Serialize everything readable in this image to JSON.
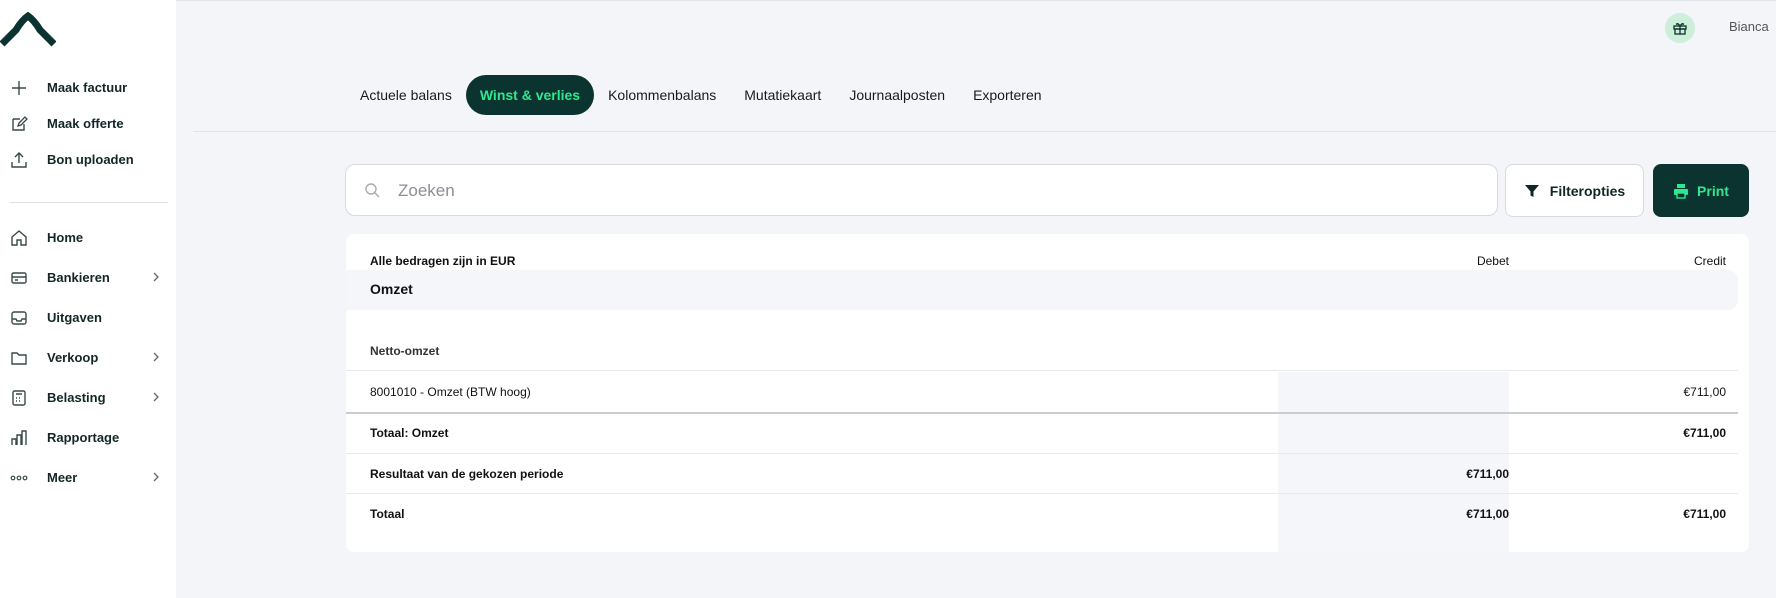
{
  "sidebar": {
    "actions": [
      {
        "label": "Maak factuur",
        "icon": "plus-icon"
      },
      {
        "label": "Maak offerte",
        "icon": "edit-icon"
      },
      {
        "label": "Bon uploaden",
        "icon": "upload-icon"
      }
    ],
    "nav": [
      {
        "label": "Home",
        "icon": "home-icon",
        "chevron": false
      },
      {
        "label": "Bankieren",
        "icon": "bank-card-icon",
        "chevron": true
      },
      {
        "label": "Uitgaven",
        "icon": "inbox-icon",
        "chevron": false
      },
      {
        "label": "Verkoop",
        "icon": "folder-icon",
        "chevron": true
      },
      {
        "label": "Belasting",
        "icon": "calculator-icon",
        "chevron": true
      },
      {
        "label": "Rapportage",
        "icon": "bar-chart-icon",
        "chevron": false
      },
      {
        "label": "Meer",
        "icon": "more-dots-icon",
        "chevron": true
      }
    ]
  },
  "header": {
    "user_name": "Bianca",
    "gift_icon": "gift-icon"
  },
  "tabs": [
    {
      "label": "Actuele balans",
      "active": false
    },
    {
      "label": "Winst & verlies",
      "active": true
    },
    {
      "label": "Kolommenbalans",
      "active": false
    },
    {
      "label": "Mutatiekaart",
      "active": false
    },
    {
      "label": "Journaalposten",
      "active": false
    },
    {
      "label": "Exporteren",
      "active": false
    }
  ],
  "search": {
    "placeholder": "Zoeken",
    "value": ""
  },
  "toolbar": {
    "filter_label": "Filteropties",
    "print_label": "Print"
  },
  "report": {
    "currency_note": "Alle bedragen zijn in EUR",
    "col_debet": "Debet",
    "col_credit": "Credit",
    "section": "Omzet",
    "subsection": "Netto-omzet",
    "account": {
      "label": "8001010 - Omzet (BTW hoog)",
      "debet": "",
      "credit": "€711,00"
    },
    "total_section": {
      "label": "Totaal: Omzet",
      "debet": "",
      "credit": "€711,00"
    },
    "result": {
      "label": "Resultaat van de gekozen periode",
      "debet": "€711,00",
      "credit": ""
    },
    "grand_total": {
      "label": "Totaal",
      "debet": "€711,00",
      "credit": "€711,00"
    }
  },
  "colors": {
    "brand_dark": "#0b3330",
    "accent_green": "#2ee88f"
  }
}
